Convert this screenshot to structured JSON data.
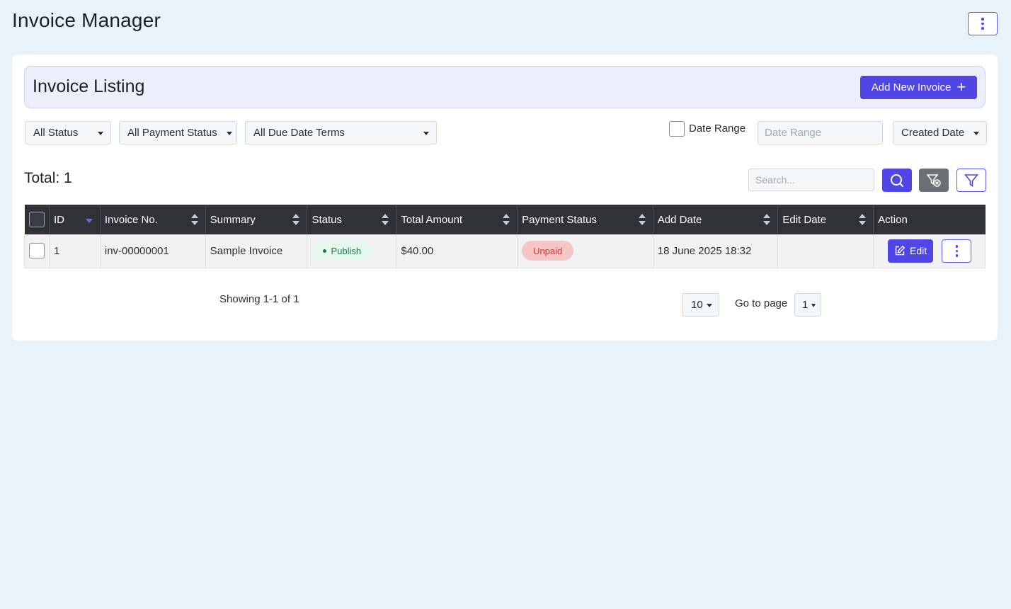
{
  "app": {
    "title": "Invoice Manager"
  },
  "listing": {
    "title": "Invoice Listing",
    "add_button_label": "Add New Invoice"
  },
  "filters": {
    "status": "All Status",
    "payment_status": "All Payment Status",
    "due_date_terms": "All Due Date Terms",
    "date_range_label": "Date Range",
    "date_range_placeholder": "Date Range",
    "sort_by": "Created Date"
  },
  "summary": {
    "total_label": "Total: 1"
  },
  "search": {
    "placeholder": "Search..."
  },
  "table": {
    "columns": [
      "ID",
      "Invoice No.",
      "Summary",
      "Status",
      "Total Amount",
      "Payment Status",
      "Add Date",
      "Edit Date",
      "Action"
    ],
    "rows": [
      {
        "id": "1",
        "invoice_no": "inv-00000001",
        "summary": "Sample Invoice",
        "status": "Publish",
        "total_amount": "$40.00",
        "payment_status": "Unpaid",
        "add_date": "18 June 2025 18:32",
        "edit_date": "",
        "edit_label": "Edit"
      }
    ]
  },
  "pagination": {
    "showing": "Showing 1-1 of 1",
    "per_page": "10",
    "goto_label": "Go to page",
    "current_page": "1"
  },
  "colors": {
    "accent": "#4f46e5",
    "header_bg": "#2f3237",
    "publish_bg": "#e6f7ee",
    "unpaid_bg": "#f4c6c6"
  }
}
